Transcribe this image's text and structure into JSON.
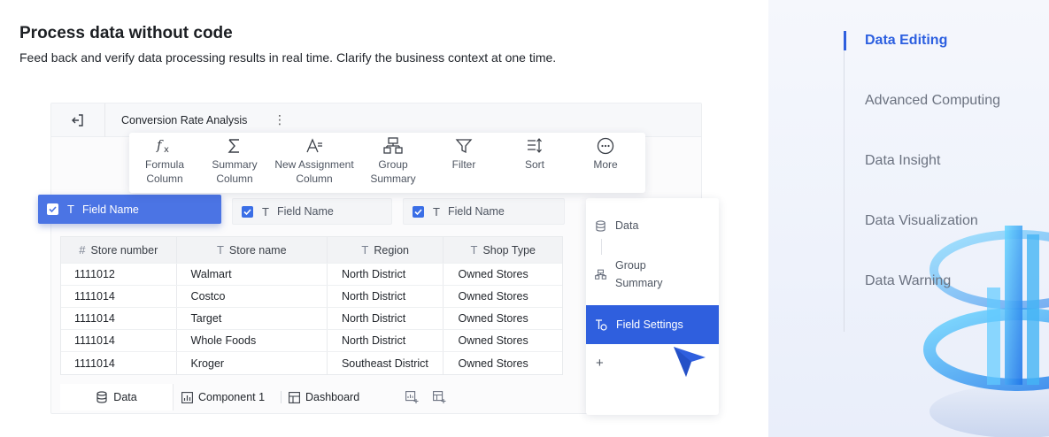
{
  "hero": {
    "title": "Process data without code",
    "subtitle": "Feed back and verify data processing results in real time. Clarify the business context at one time."
  },
  "app": {
    "title": "Conversion Rate Analysis",
    "menu_glyph": "⋮"
  },
  "toolbar": {
    "tools": [
      {
        "icon": "fx-icon",
        "line1": "Formula",
        "line2": "Column"
      },
      {
        "icon": "sigma-icon",
        "line1": "Summary",
        "line2": "Column"
      },
      {
        "icon": "assignment-icon",
        "line1": "New Assignment",
        "line2": "Column"
      },
      {
        "icon": "group-icon",
        "line1": "Group",
        "line2": "Summary"
      },
      {
        "icon": "filter-icon",
        "line1": "Filter",
        "line2": ""
      },
      {
        "icon": "sort-icon",
        "line1": "Sort",
        "line2": ""
      },
      {
        "icon": "more-icon",
        "line1": "More",
        "line2": ""
      }
    ]
  },
  "field_chips": [
    {
      "label": "Field Name",
      "checked": true
    },
    {
      "label": "Field Name",
      "checked": true
    },
    {
      "label": "Field Name",
      "checked": true
    }
  ],
  "table": {
    "headers": [
      {
        "icon": "#",
        "label": "Store number"
      },
      {
        "icon": "T",
        "label": "Store name"
      },
      {
        "icon": "T",
        "label": "Region"
      },
      {
        "icon": "T",
        "label": "Shop Type"
      }
    ],
    "rows": [
      [
        "1111012",
        "Walmart",
        "North District",
        "Owned Stores"
      ],
      [
        "1111014",
        "Costco",
        "North District",
        "Owned Stores"
      ],
      [
        "1111014",
        "Target",
        "North District",
        "Owned Stores"
      ],
      [
        "1111014",
        "Whole Foods",
        "North District",
        "Owned Stores"
      ],
      [
        "1111014",
        "Kroger",
        "Southeast District",
        "Owned Stores"
      ]
    ]
  },
  "tabs": {
    "data": "Data",
    "component": "Component 1",
    "dashboard": "Dashboard"
  },
  "side_panel": {
    "data": "Data",
    "group_line1": "Group",
    "group_line2": "Summary",
    "field_settings": "Field Settings",
    "plus": "+"
  },
  "nav": {
    "items": [
      "Data Editing",
      "Advanced Computing",
      "Data Insight",
      "Data Visualization",
      "Data Warning"
    ],
    "active_index": 0
  },
  "colors": {
    "accent": "#2f5fde",
    "chip_blue": "#4b74e4",
    "nav_active": "#2c5fe0"
  }
}
